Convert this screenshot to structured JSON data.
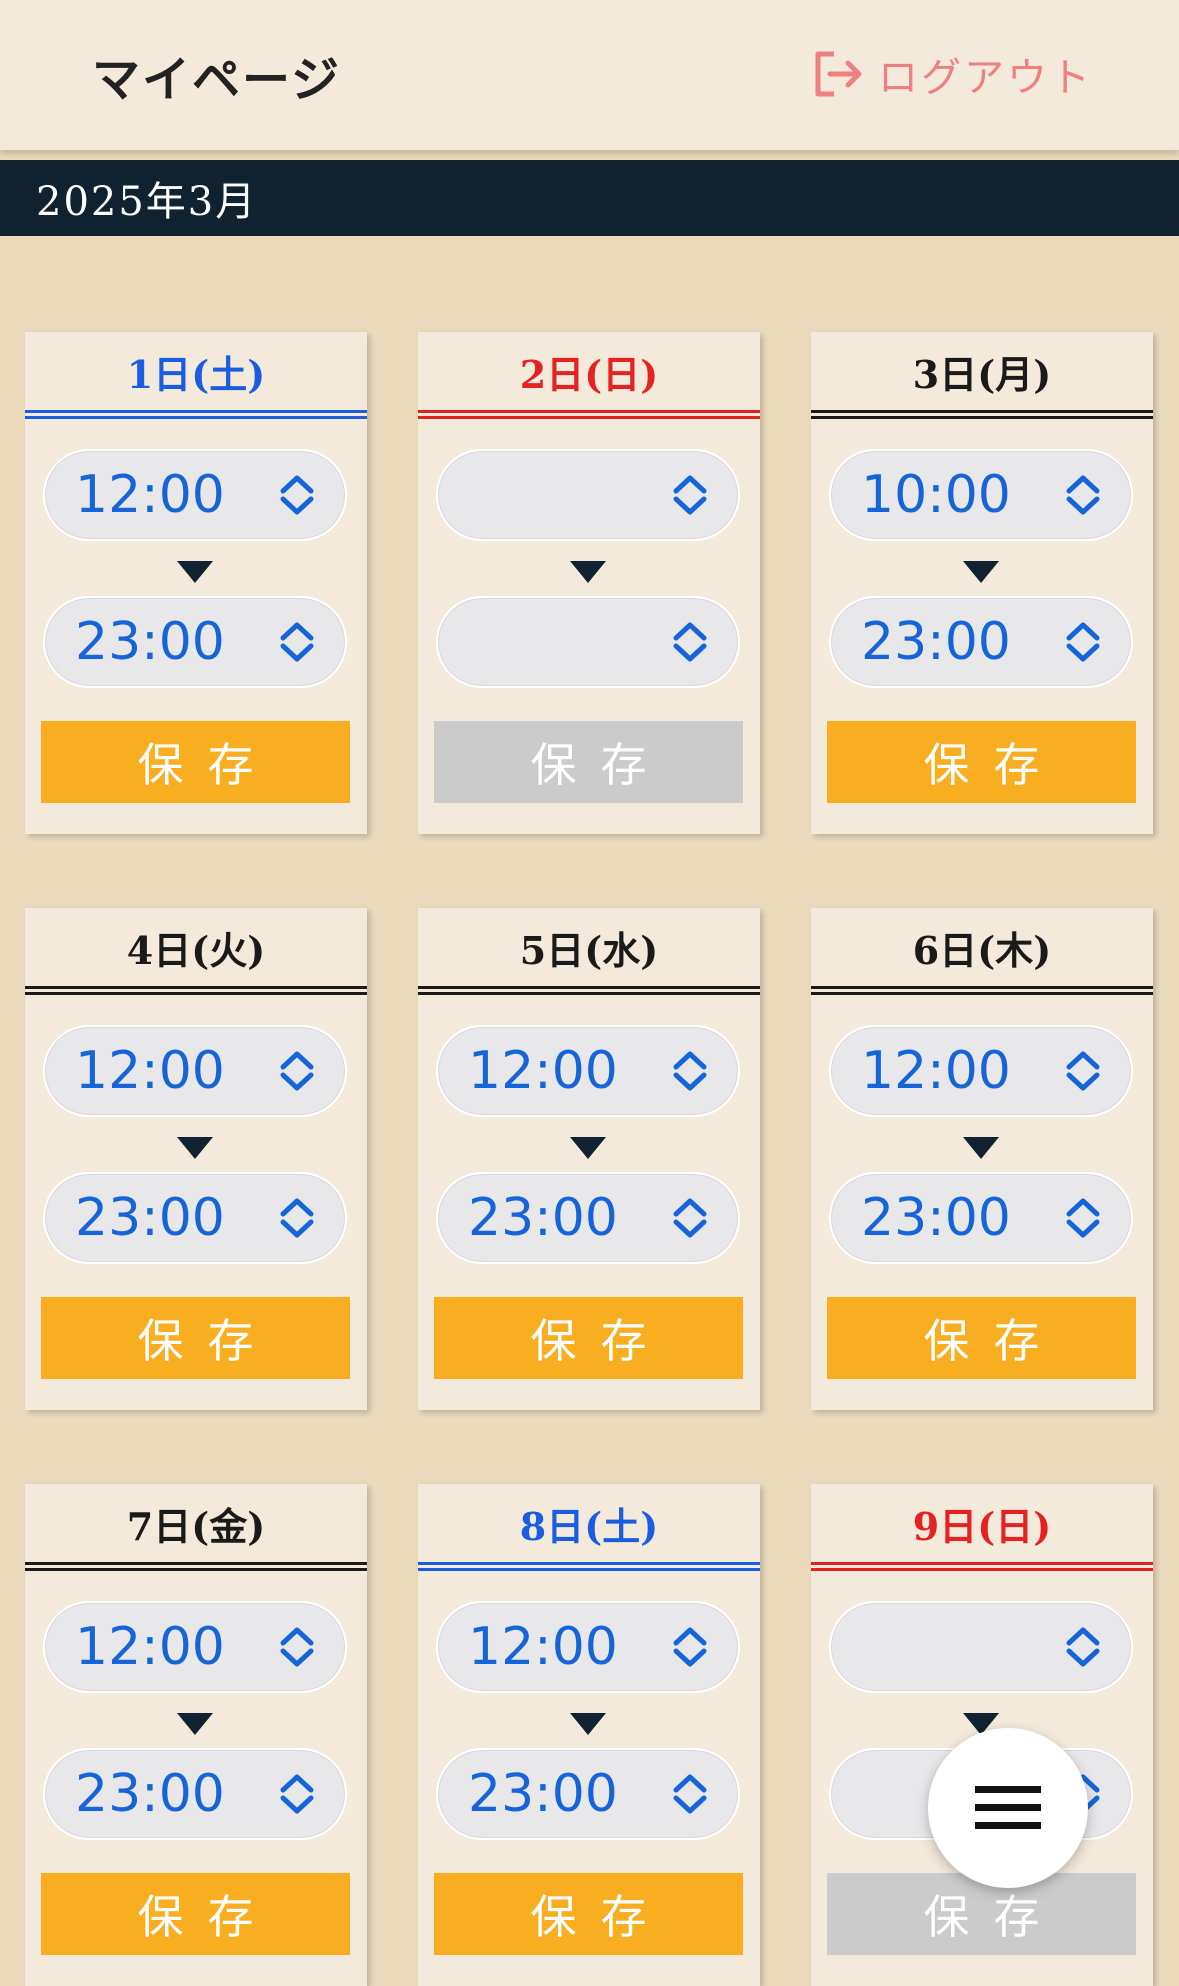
{
  "header": {
    "title": "マイページ",
    "logout_label": "ログアウト"
  },
  "month": "2025年3月",
  "colors": {
    "saturday": "#1a5de0",
    "sunday": "#e52222",
    "weekday": "#1a1a1a",
    "save_active": "#f9ae22",
    "save_inactive": "#cbcbcb",
    "time_text": "#1665d8"
  },
  "save_label": "保存",
  "days": [
    {
      "label": "1日(土)",
      "type": "sat",
      "start": "12:00",
      "end": "23:00",
      "save_enabled": true
    },
    {
      "label": "2日(日)",
      "type": "sun",
      "start": "",
      "end": "",
      "save_enabled": false
    },
    {
      "label": "3日(月)",
      "type": "weekday",
      "start": "10:00",
      "end": "23:00",
      "save_enabled": true
    },
    {
      "label": "4日(火)",
      "type": "weekday",
      "start": "12:00",
      "end": "23:00",
      "save_enabled": true
    },
    {
      "label": "5日(水)",
      "type": "weekday",
      "start": "12:00",
      "end": "23:00",
      "save_enabled": true
    },
    {
      "label": "6日(木)",
      "type": "weekday",
      "start": "12:00",
      "end": "23:00",
      "save_enabled": true
    },
    {
      "label": "7日(金)",
      "type": "weekday",
      "start": "12:00",
      "end": "23:00",
      "save_enabled": true
    },
    {
      "label": "8日(土)",
      "type": "sat",
      "start": "12:00",
      "end": "23:00",
      "save_enabled": true
    },
    {
      "label": "9日(日)",
      "type": "sun",
      "start": "",
      "end": "",
      "save_enabled": false
    }
  ],
  "menu_icon": "hamburger-menu-icon"
}
